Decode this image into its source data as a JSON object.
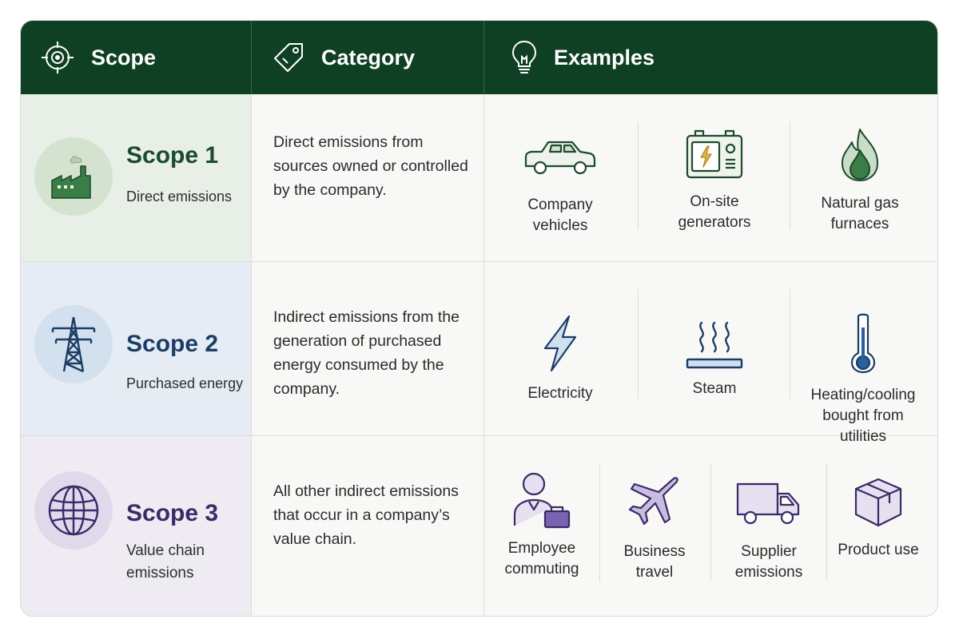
{
  "header": {
    "scope_label": "Scope",
    "category_label": "Category",
    "examples_label": "Examples",
    "bg": "#0f4024"
  },
  "scopes": [
    {
      "name": "Scope 1",
      "subtitle": "Direct emissions",
      "description": "Direct emissions from sources owned or controlled by the company.",
      "accent": "#1d4a2c",
      "tint": "#e8efe6",
      "icon": "factory-icon",
      "examples": [
        {
          "label": "Company vehicles",
          "icon": "car-icon"
        },
        {
          "label": "On-site generators",
          "icon": "generator-icon"
        },
        {
          "label": "Natural gas furnaces",
          "icon": "flame-icon"
        }
      ]
    },
    {
      "name": "Scope 2",
      "subtitle": "Purchased energy",
      "description": "Indirect emissions from the generation of purchased energy consumed by the company.",
      "accent": "#1c3d66",
      "tint": "#e6ecf4",
      "icon": "transmission-tower-icon",
      "examples": [
        {
          "label": "Electricity",
          "icon": "lightning-icon"
        },
        {
          "label": "Steam",
          "icon": "steam-icon"
        },
        {
          "label": "Heating/cooling bought from utilities",
          "icon": "thermometer-icon"
        }
      ]
    },
    {
      "name": "Scope 3",
      "subtitle": "Value chain emissions",
      "description": "All other indirect emissions that occur in a company’s value chain.",
      "accent": "#3b2a66",
      "tint": "#eeebf3",
      "icon": "globe-icon",
      "examples": [
        {
          "label": "Employee commuting",
          "icon": "employee-icon"
        },
        {
          "label": "Business travel",
          "icon": "airplane-icon"
        },
        {
          "label": "Supplier emissions",
          "icon": "truck-icon"
        },
        {
          "label": "Product use",
          "icon": "box-icon"
        }
      ]
    }
  ]
}
